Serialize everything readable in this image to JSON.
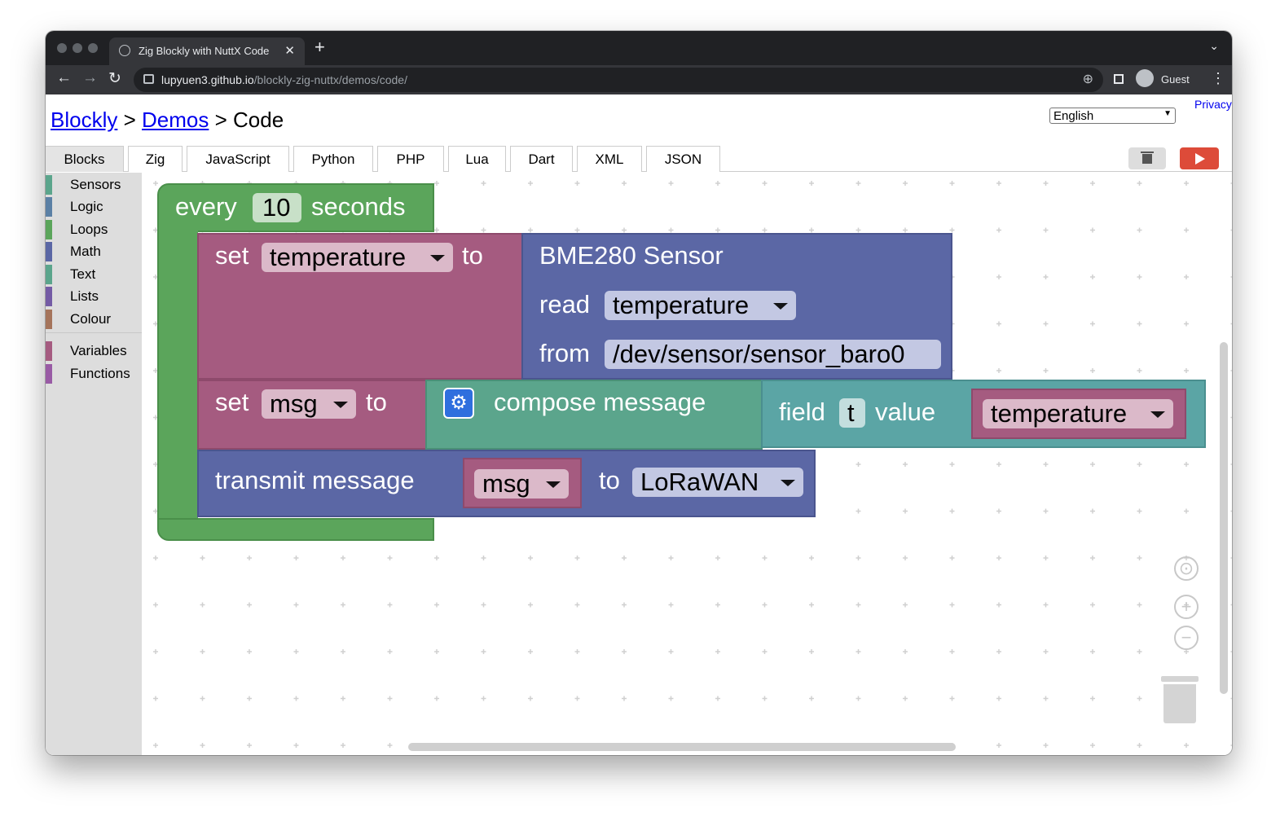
{
  "browser": {
    "tab_title": "Zig Blockly with NuttX Code",
    "tab_close": "✕",
    "new_tab": "+",
    "tab_menu": "⌄",
    "url_host": "lupyuen3.github.io",
    "url_path": "/blockly-zig-nuttx/demos/code/",
    "back": "←",
    "forward": "→",
    "reload": "↻",
    "zoom_icon": "⊕",
    "profile_name": "Guest",
    "menu": "⋮"
  },
  "page": {
    "breadcrumb": {
      "link1": "Blockly",
      "sep1": " > ",
      "link2": "Demos",
      "sep2": " > ",
      "current": "Code"
    },
    "language": "English",
    "privacy": "Privacy",
    "tabs": [
      {
        "label": "Blocks",
        "selected": true
      },
      {
        "label": "Zig"
      },
      {
        "label": "JavaScript"
      },
      {
        "label": "Python"
      },
      {
        "label": "PHP"
      },
      {
        "label": "Lua"
      },
      {
        "label": "Dart"
      },
      {
        "label": "XML"
      },
      {
        "label": "JSON"
      }
    ]
  },
  "toolbox": {
    "categories": [
      {
        "label": "Sensors",
        "color": "#5ba58c"
      },
      {
        "label": "Logic",
        "color": "#5b80a5"
      },
      {
        "label": "Loops",
        "color": "#5ba55b"
      },
      {
        "label": "Math",
        "color": "#5b67a5"
      },
      {
        "label": "Text",
        "color": "#5ba58c"
      },
      {
        "label": "Lists",
        "color": "#745ba5"
      },
      {
        "label": "Colour",
        "color": "#a5745b"
      },
      {
        "label": "Variables",
        "color": "#a55b80"
      },
      {
        "label": "Functions",
        "color": "#995ba5"
      }
    ]
  },
  "blocks": {
    "every": {
      "prefix": "every",
      "value": "10",
      "suffix": "seconds",
      "color": "#5ba55b"
    },
    "set_temp": {
      "set": "set",
      "var": "temperature",
      "to": "to",
      "color": "#a55b80"
    },
    "sensor": {
      "title": "BME280 Sensor",
      "read": "read",
      "read_value": "temperature",
      "from": "from",
      "device": "/dev/sensor/sensor_baro0",
      "color": "#5b67a5"
    },
    "set_msg": {
      "set": "set",
      "var": "msg",
      "to": "to"
    },
    "compose": {
      "label": "compose message",
      "color": "#5ba58c"
    },
    "field": {
      "field": "field",
      "name": "t",
      "value": "value",
      "var": "temperature"
    },
    "transmit": {
      "label": "transmit message",
      "var": "msg",
      "to": "to",
      "target": "LoRaWAN"
    }
  },
  "controls": {
    "zoom_in": "+",
    "zoom_out": "−"
  }
}
